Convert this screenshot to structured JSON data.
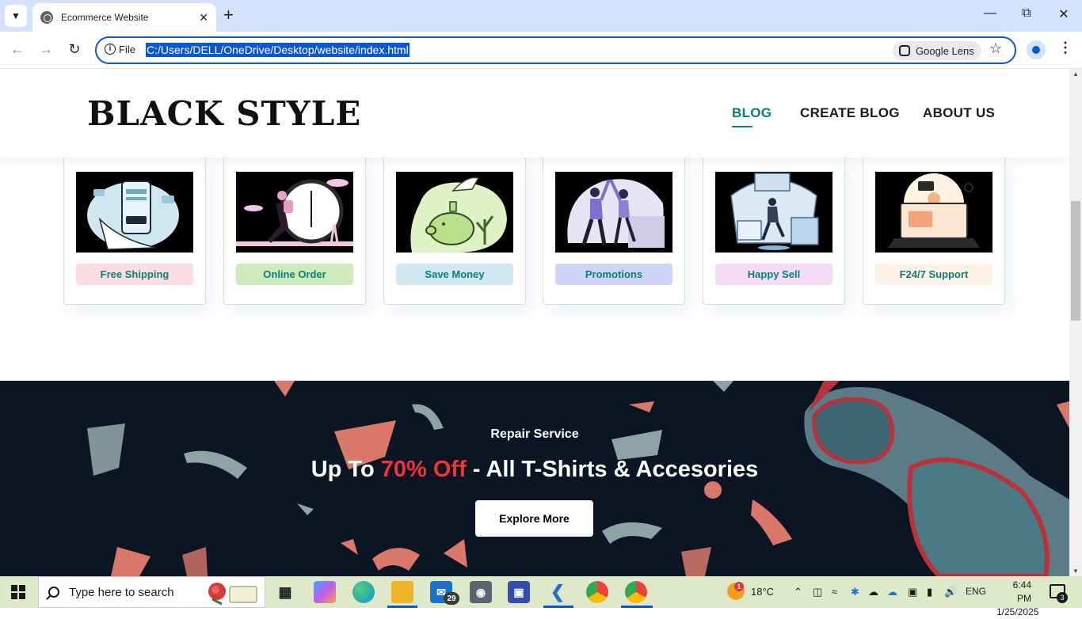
{
  "browser": {
    "tab_title": "Ecommerce Website",
    "url_scheme_label": "File",
    "url": "C:/Users/DELL/OneDrive/Desktop/website/index.html",
    "lens_label": "Google Lens"
  },
  "site": {
    "logo": "BLACK STYLE",
    "nav": [
      {
        "label": "BLOG",
        "active": true
      },
      {
        "label": "CREATE BLOG",
        "active": false
      },
      {
        "label": "ABOUT US",
        "active": false
      }
    ],
    "features": [
      {
        "label": "Free Shipping",
        "bg": "#fddde4",
        "icon": "shipping-illustration-icon"
      },
      {
        "label": "Online Order",
        "bg": "#cdebbc",
        "icon": "clock-runner-illustration-icon"
      },
      {
        "label": "Save Money",
        "bg": "#d1e8f2",
        "icon": "piggy-bank-illustration-icon"
      },
      {
        "label": "Promotions",
        "bg": "#cdd4f8",
        "icon": "high-five-illustration-icon"
      },
      {
        "label": "Happy Sell",
        "bg": "#f6dbf6",
        "icon": "happy-shopper-illustration-icon"
      },
      {
        "label": "F24/7 Support",
        "bg": "#fff2e5",
        "icon": "support-agent-illustration-icon"
      }
    ],
    "banner": {
      "kicker": "Repair Service",
      "headline_prefix": "Up To ",
      "headline_highlight": "70% Off",
      "headline_suffix": " - All T-Shirts & Accesories",
      "button": "Explore More"
    }
  },
  "taskbar": {
    "search_placeholder": "Type here to search",
    "mail_badge": "29",
    "weather": "18°C",
    "weather_badge": "1",
    "language": "ENG",
    "time": "6:44 PM",
    "date": "1/25/2025",
    "notifications": "3"
  },
  "colors": {
    "accent": "#088178",
    "highlight": "#ef3636",
    "banner_bg": "#0b1523",
    "chrome_blue": "#0b57d0"
  }
}
